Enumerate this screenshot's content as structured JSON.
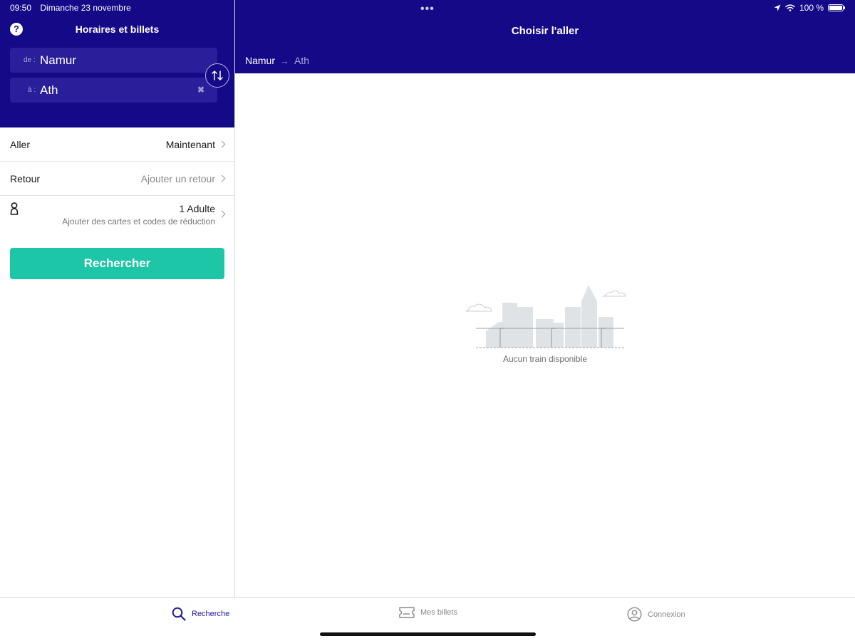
{
  "status_bar": {
    "time": "09:50",
    "date": "Dimanche 23 novembre",
    "battery": "100 %",
    "multitask_dots": "•••"
  },
  "left_panel": {
    "title": "Horaires et billets",
    "help_icon": "?",
    "from": {
      "prefix": "de :",
      "value": "Namur"
    },
    "to": {
      "prefix": "à :",
      "value": "Ath",
      "clear_icon": "✖"
    },
    "swap_icon": "swap-arrows-icon",
    "outbound": {
      "label": "Aller",
      "value": "Maintenant"
    },
    "return": {
      "label": "Retour",
      "value": "Ajouter un retour"
    },
    "passengers": {
      "value": "1 Adulte",
      "discounts": "Ajouter des cartes et codes de réduction"
    },
    "search_button": "Rechercher"
  },
  "right_panel": {
    "title": "Choisir l'aller",
    "route": {
      "from": "Namur",
      "arrow": "→",
      "to": "Ath"
    },
    "empty_state": "Aucun train disponible"
  },
  "tabs": [
    {
      "label": "Recherche",
      "icon": "search-icon",
      "active": true
    },
    {
      "label": "Mes billets",
      "icon": "ticket-icon",
      "active": false
    },
    {
      "label": "Connexion",
      "icon": "user-circle-icon",
      "active": false
    }
  ],
  "colors": {
    "header": "#140a88",
    "accent": "#1cc6a6",
    "active_tab": "#1e1a9c"
  }
}
